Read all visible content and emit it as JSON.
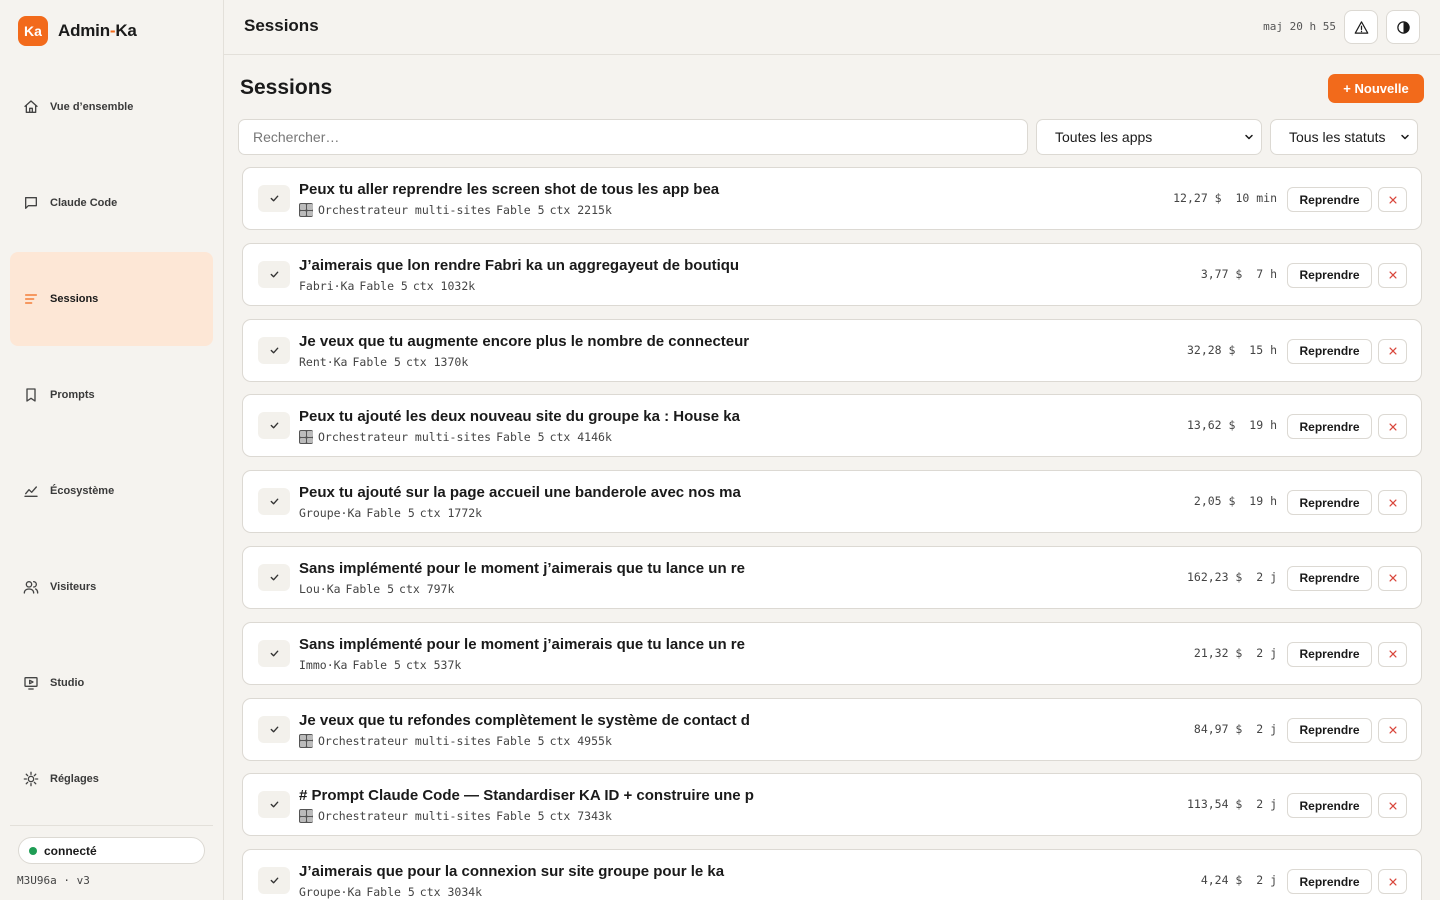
{
  "brand": {
    "logo": "Ka",
    "name_main": "Admin",
    "name_sep": "-",
    "name_suffix": "Ka",
    "accent_color": "#f26a1b"
  },
  "sidebar": {
    "items": [
      {
        "label": "Vue d’ensemble",
        "icon": "home-icon"
      },
      {
        "label": "Claude Code",
        "icon": "chat-icon"
      },
      {
        "label": "Sessions",
        "icon": "list-icon",
        "active": true
      },
      {
        "label": "Prompts",
        "icon": "bookmark-icon"
      },
      {
        "label": "Écosystème",
        "icon": "chart-icon"
      },
      {
        "label": "Visiteurs",
        "icon": "users-icon"
      },
      {
        "label": "Studio",
        "icon": "monitor-icon"
      },
      {
        "label": "Réglages",
        "icon": "sun-gear-icon"
      }
    ],
    "status": "connecté",
    "version": "M3U96a · v3"
  },
  "topbar": {
    "title": "Sessions",
    "updated": "maj 20 h 55"
  },
  "main": {
    "title": "Sessions",
    "new_button": "+ Nouvelle",
    "search_placeholder": "Rechercher…",
    "filter_apps": "Toutes les apps",
    "filter_status": "Tous les statuts",
    "resume_label": "Reprendre"
  },
  "sessions": [
    {
      "title": "Peux tu aller reprendre les screen shot de tous les app bea",
      "app": "Orchestrateur multi-sites",
      "app_icon": true,
      "model": "Fable 5",
      "ctx": "ctx 2215k",
      "cost": "12,27 $",
      "age": "10 min"
    },
    {
      "title": "J’aimerais que lon rendre Fabri ka un aggregayeut de boutiqu",
      "app": "Fabri·Ka",
      "app_icon": false,
      "model": "Fable 5",
      "ctx": "ctx 1032k",
      "cost": "3,77 $",
      "age": "7 h"
    },
    {
      "title": "Je veux que tu augmente encore plus le nombre de connecteur",
      "app": "Rent·Ka",
      "app_icon": false,
      "model": "Fable 5",
      "ctx": "ctx 1370k",
      "cost": "32,28 $",
      "age": "15 h"
    },
    {
      "title": "Peux tu ajouté les deux nouveau site du groupe ka : House ka",
      "app": "Orchestrateur multi-sites",
      "app_icon": true,
      "model": "Fable 5",
      "ctx": "ctx 4146k",
      "cost": "13,62 $",
      "age": "19 h"
    },
    {
      "title": "Peux tu ajouté sur la page accueil une banderole avec nos ma",
      "app": "Groupe·Ka",
      "app_icon": false,
      "model": "Fable 5",
      "ctx": "ctx 1772k",
      "cost": "2,05 $",
      "age": "19 h"
    },
    {
      "title": "Sans implémenté pour le moment j’aimerais que tu lance un re",
      "app": "Lou·Ka",
      "app_icon": false,
      "model": "Fable 5",
      "ctx": "ctx 797k",
      "cost": "162,23 $",
      "age": "2 j"
    },
    {
      "title": "Sans implémenté pour le moment j’aimerais que tu lance un re",
      "app": "Immo·Ka",
      "app_icon": false,
      "model": "Fable 5",
      "ctx": "ctx 537k",
      "cost": "21,32 $",
      "age": "2 j"
    },
    {
      "title": "Je veux que tu refondes complètement le système de contact d",
      "app": "Orchestrateur multi-sites",
      "app_icon": true,
      "model": "Fable 5",
      "ctx": "ctx 4955k",
      "cost": "84,97 $",
      "age": "2 j"
    },
    {
      "title": "# Prompt Claude Code — Standardiser KA ID + construire une p",
      "app": "Orchestrateur multi-sites",
      "app_icon": true,
      "model": "Fable 5",
      "ctx": "ctx 7343k",
      "cost": "113,54 $",
      "age": "2 j"
    },
    {
      "title": "J’aimerais que pour la connexion sur site groupe pour le ka",
      "app": "Groupe·Ka",
      "app_icon": false,
      "model": "Fable 5",
      "ctx": "ctx 3034k",
      "cost": "4,24 $",
      "age": "2 j"
    }
  ]
}
